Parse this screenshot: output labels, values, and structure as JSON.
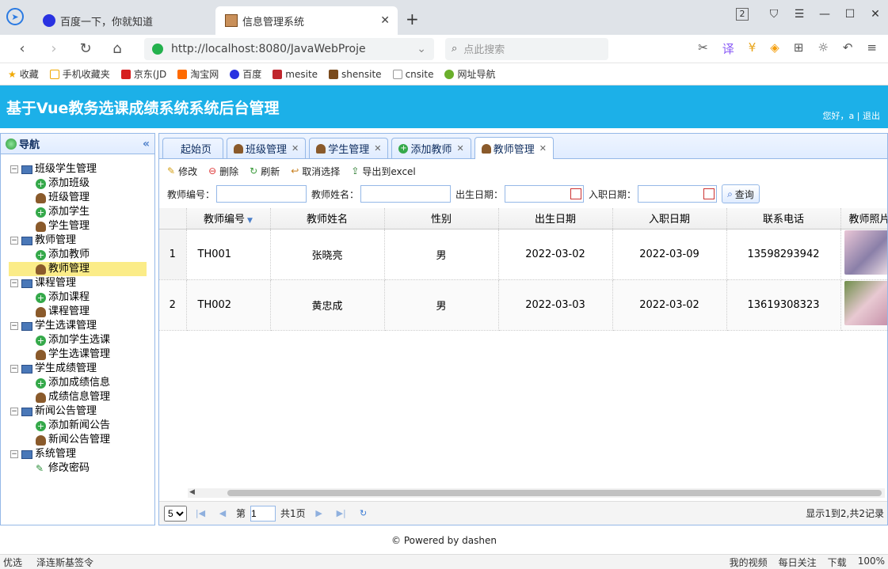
{
  "browser": {
    "tabs": [
      {
        "title": "百度一下，你就知道"
      },
      {
        "title": "信息管理系统"
      }
    ],
    "window_tab_count": "2",
    "url": "http://localhost:8080/JavaWebProje",
    "search_placeholder": "点此搜索",
    "bookmarks": [
      "收藏",
      "手机收藏夹",
      "京东(JD",
      "淘宝网",
      "百度",
      "mesite",
      "shensite",
      "cnsite",
      "网址导航"
    ]
  },
  "app": {
    "title": "基于Vue教务选课成绩系统系统后台管理",
    "greeting": "您好，a",
    "separator": "|",
    "logout": "退出"
  },
  "sidebar": {
    "title": "导航",
    "groups": [
      {
        "label": "班级学生管理",
        "items": [
          "添加班级",
          "班级管理",
          "添加学生",
          "学生管理"
        ]
      },
      {
        "label": "教师管理",
        "items": [
          "添加教师",
          "教师管理"
        ]
      },
      {
        "label": "课程管理",
        "items": [
          "添加课程",
          "课程管理"
        ]
      },
      {
        "label": "学生选课管理",
        "items": [
          "添加学生选课",
          "学生选课管理"
        ]
      },
      {
        "label": "学生成绩管理",
        "items": [
          "添加成绩信息",
          "成绩信息管理"
        ]
      },
      {
        "label": "新闻公告管理",
        "items": [
          "添加新闻公告",
          "新闻公告管理"
        ]
      },
      {
        "label": "系统管理",
        "items": [
          "修改密码"
        ]
      }
    ]
  },
  "tabs": [
    "起始页",
    "班级管理",
    "学生管理",
    "添加教师",
    "教师管理"
  ],
  "toolbar": {
    "edit": "修改",
    "delete": "删除",
    "refresh": "刷新",
    "unselect": "取消选择",
    "export": "导出到excel"
  },
  "filters": {
    "teacher_no": "教师编号：",
    "teacher_name": "教师姓名：",
    "birth_date": "出生日期：",
    "join_date": "入职日期：",
    "query": "查询"
  },
  "grid": {
    "columns": [
      "教师编号",
      "教师姓名",
      "性别",
      "出生日期",
      "入职日期",
      "联系电话",
      "教师照片"
    ],
    "rows": [
      {
        "rn": "1",
        "no": "TH001",
        "name": "张晓亮",
        "sex": "男",
        "birth": "2022-03-02",
        "join": "2022-03-09",
        "phone": "13598293942"
      },
      {
        "rn": "2",
        "no": "TH002",
        "name": "黄忠成",
        "sex": "男",
        "birth": "2022-03-03",
        "join": "2022-03-02",
        "phone": "13619308323"
      }
    ]
  },
  "pager": {
    "page_size": "5",
    "page_label": "第",
    "page_value": "1",
    "total_pages": "共1页",
    "info": "显示1到2,共2记录"
  },
  "footer": "© Powered by dashen",
  "statusbar": {
    "left1": "优选",
    "left2": "泽连斯基签令",
    "items": [
      "我的视频",
      "每日关注",
      "下载"
    ],
    "zoom": "100%"
  }
}
